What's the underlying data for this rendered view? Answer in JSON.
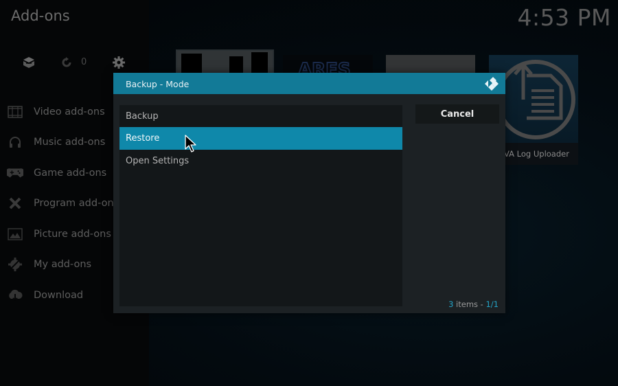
{
  "window": {
    "title": "Add-ons",
    "clock": "4:53 PM"
  },
  "top_icons": {
    "addon_box": "addon-box-icon",
    "updates": "refresh-icon",
    "update_count": "0",
    "settings": "gear-icon"
  },
  "sidebar": {
    "items": [
      {
        "label": "Video add-ons",
        "icon": "film-icon"
      },
      {
        "label": "Music add-ons",
        "icon": "headphones-icon"
      },
      {
        "label": "Game add-ons",
        "icon": "gamepad-icon"
      },
      {
        "label": "Program add-ons",
        "icon": "tools-icon"
      },
      {
        "label": "Picture add-ons",
        "icon": "picture-icon"
      },
      {
        "label": "My add-ons",
        "icon": "gear-wrench-icon"
      },
      {
        "label": "Download",
        "icon": "cloud-download-icon"
      }
    ]
  },
  "tiles": [
    {
      "name": "addon-tile-1"
    },
    {
      "name": "addon-tile-2",
      "logo_text": "ARES"
    },
    {
      "name": "addon-tile-3"
    },
    {
      "name": "addon-tile-4",
      "caption": "VA Log Uploader"
    }
  ],
  "dialog": {
    "title": "Backup - Mode",
    "options": [
      {
        "label": "Backup",
        "selected": false
      },
      {
        "label": "Restore",
        "selected": true
      },
      {
        "label": "Open Settings",
        "selected": false
      }
    ],
    "cancel_label": "Cancel",
    "count": {
      "items": "3",
      "items_label": " items - ",
      "page": "1/1"
    }
  },
  "colors": {
    "accent": "#127a97",
    "selection": "#0f88aa",
    "highlight_text": "#24a3c6"
  }
}
